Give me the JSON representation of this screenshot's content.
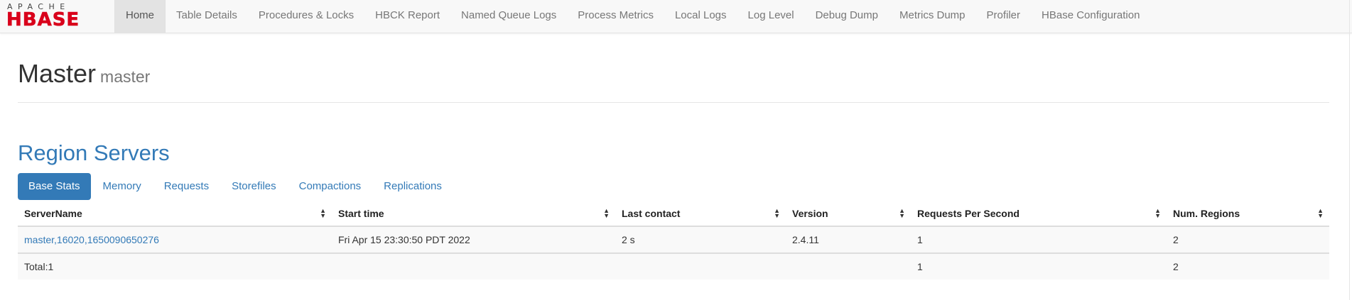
{
  "brand": {
    "logo_top": "APACHE",
    "logo_main": "HBASE",
    "logo_color": "#d9001b"
  },
  "nav": {
    "items": [
      {
        "label": "Home",
        "active": true
      },
      {
        "label": "Table Details"
      },
      {
        "label": "Procedures & Locks"
      },
      {
        "label": "HBCK Report"
      },
      {
        "label": "Named Queue Logs"
      },
      {
        "label": "Process Metrics"
      },
      {
        "label": "Local Logs"
      },
      {
        "label": "Log Level"
      },
      {
        "label": "Debug Dump"
      },
      {
        "label": "Metrics Dump"
      },
      {
        "label": "Profiler"
      },
      {
        "label": "HBase Configuration"
      }
    ]
  },
  "header": {
    "title": "Master",
    "subtitle": "master"
  },
  "region_servers": {
    "title": "Region Servers",
    "tabs": [
      {
        "label": "Base Stats",
        "active": true
      },
      {
        "label": "Memory"
      },
      {
        "label": "Requests"
      },
      {
        "label": "Storefiles"
      },
      {
        "label": "Compactions"
      },
      {
        "label": "Replications"
      }
    ],
    "columns": [
      "ServerName",
      "Start time",
      "Last contact",
      "Version",
      "Requests Per Second",
      "Num. Regions"
    ],
    "rows": [
      {
        "server_name": "master,16020,1650090650276",
        "start_time": "Fri Apr 15 23:30:50 PDT 2022",
        "last_contact": "2 s",
        "version": "2.4.11",
        "requests_per_second": "1",
        "num_regions": "2"
      }
    ],
    "total": {
      "label": "Total:1",
      "requests_per_second": "1",
      "num_regions": "2"
    }
  },
  "colors": {
    "accent": "#337ab7",
    "navbar_bg": "#f8f8f8",
    "active_nav_bg": "#e3e3e3"
  }
}
